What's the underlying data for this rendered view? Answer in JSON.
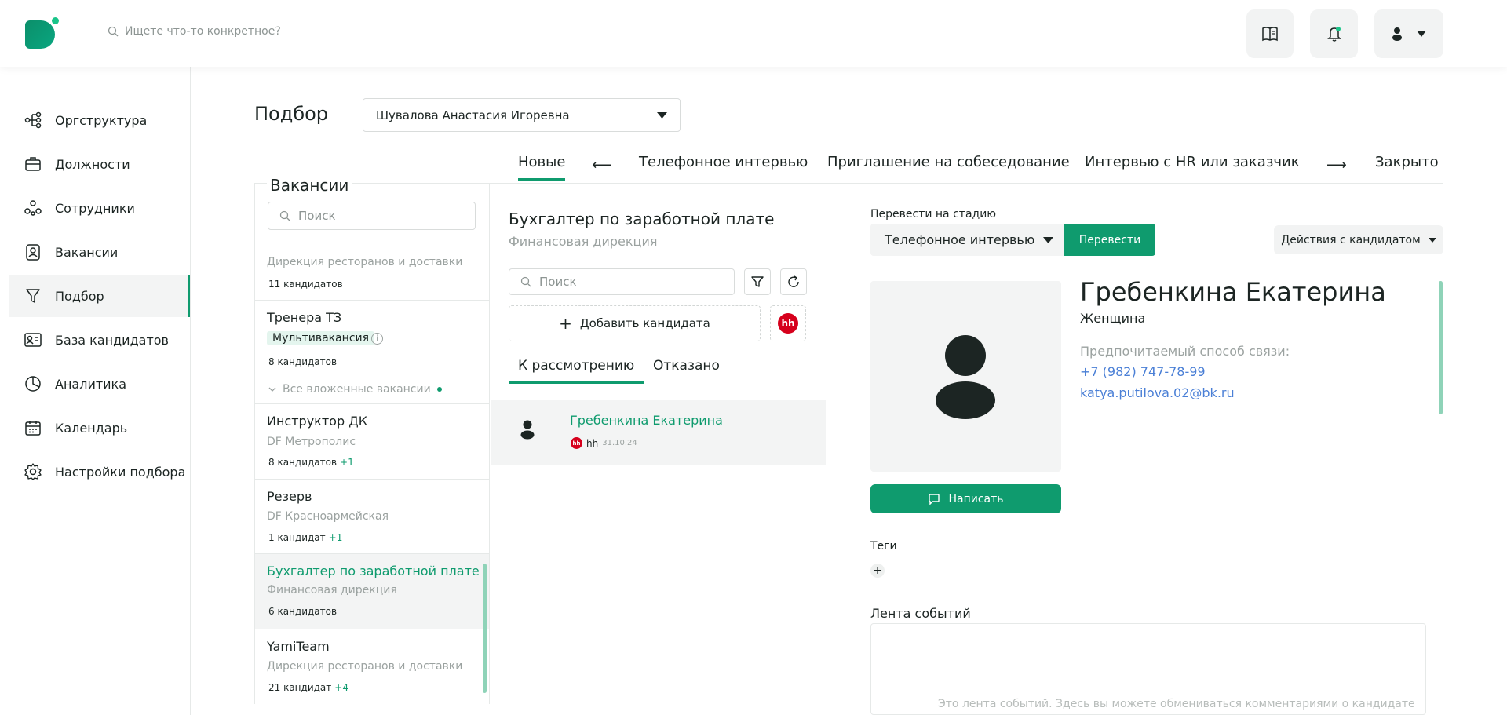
{
  "header": {
    "search_placeholder": "Ищете что-то конкретное?"
  },
  "sidebar": {
    "items": [
      {
        "label": "Оргструктура",
        "icon": "org-structure-icon"
      },
      {
        "label": "Должности",
        "icon": "briefcase-icon"
      },
      {
        "label": "Сотрудники",
        "icon": "people-icon"
      },
      {
        "label": "Вакансии",
        "icon": "vacancy-badge-icon"
      },
      {
        "label": "Подбор",
        "icon": "funnel-icon",
        "active": true
      },
      {
        "label": "База кандидатов",
        "icon": "id-card-icon"
      },
      {
        "label": "Аналитика",
        "icon": "pie-chart-icon"
      },
      {
        "label": "Календарь",
        "icon": "calendar-icon"
      },
      {
        "label": "Настройки подбора",
        "icon": "gear-icon"
      }
    ]
  },
  "page": {
    "title": "Подбор",
    "recruiter": "Шувалова Анастасия Игоревна"
  },
  "stages": [
    "Новые",
    "Телефонное интервью",
    "Приглашение на собеседование",
    "Интервью с HR или заказчик",
    "Закрыто"
  ],
  "vacancies": {
    "title": "Вакансии",
    "search_placeholder": "Поиск",
    "items": [
      {
        "sub": "Дирекция ресторанов и доставки",
        "count": "11 кандидатов"
      },
      {
        "name": "Тренера ТЗ",
        "badge": "Мультивакансия",
        "count": "8 кандидатов",
        "nested": "Все вложенные вакансии"
      },
      {
        "name": "Инструктор ДК",
        "sub": "DF Метрополис",
        "count": "8 кандидатов",
        "plus": "+1"
      },
      {
        "name": "Резерв",
        "sub": "DF Красноармейская",
        "count": "1 кандидат",
        "plus": "+1"
      },
      {
        "name": "Бухгалтер по заработной плате",
        "sub": "Финансовая дирекция",
        "count": "6 кандидатов",
        "selected": true
      },
      {
        "name": "YamiTeam",
        "sub": "Дирекция ресторанов и доставки",
        "count": "21 кандидат",
        "plus": "+4"
      }
    ]
  },
  "middle": {
    "title": "Бухгалтер по заработной плате",
    "subtitle": "Финансовая дирекция",
    "search_placeholder": "Поиск",
    "add_label": "Добавить кандидата",
    "hh_label": "hh",
    "tabs": [
      "К рассмотрению",
      "Отказано"
    ],
    "candidates": [
      {
        "name": "Гребенкина Екатерина",
        "source": "hh",
        "date": "31.10.24"
      }
    ]
  },
  "detail": {
    "move_label": "Перевести на стадию",
    "stage_value": "Телефонное интервью",
    "move_button": "Перевести",
    "actions_button": "Действия с кандидатом",
    "name": "Гребенкина Екатерина",
    "gender": "Женщина",
    "pref_label": "Предпочитаемый способ связи:",
    "phone": "+7 (982) 747-78-99",
    "email": "katya.putilova.02@bk.ru",
    "write_button": "Написать",
    "tags_label": "Теги",
    "feed_label": "Лента событий",
    "feed_text": "Это лента событий. Здесь вы можете обмениваться комментариями о кандидате"
  },
  "colors": {
    "accent": "#0f9b6e",
    "link": "#4a7fd6",
    "hh": "#d6001c"
  }
}
